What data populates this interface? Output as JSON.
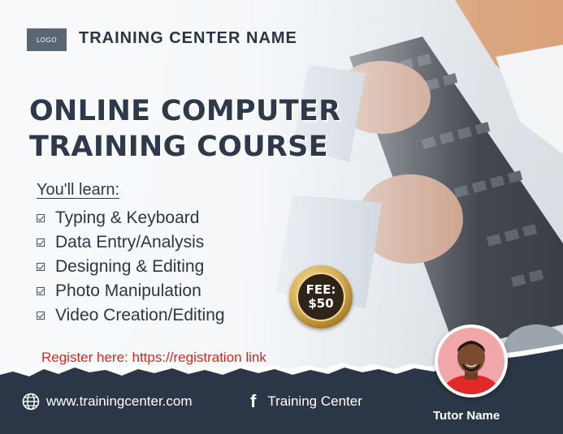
{
  "logo": {
    "text": "LOGO"
  },
  "center_name": "TRAINING CENTER NAME",
  "title": {
    "line1": "ONLINE COMPUTER",
    "line2": "TRAINING COURSE"
  },
  "learn": {
    "heading": "You'll learn:",
    "items": [
      {
        "label": "Typing & Keyboard"
      },
      {
        "label": "Data Entry/Analysis"
      },
      {
        "label": "Designing & Editing"
      },
      {
        "label": "Photo Manipulation"
      },
      {
        "label": "Video Creation/Editing"
      }
    ]
  },
  "fee": {
    "label": "FEE:",
    "amount": "$50"
  },
  "register": "Register here: https://registration link",
  "footer": {
    "website": "www.trainingcenter.com",
    "website_icon": "globe-icon",
    "facebook": "Training Center",
    "facebook_icon": "facebook-icon"
  },
  "tutor": {
    "name": "Tutor Name"
  },
  "colors": {
    "navy": "#2b3646",
    "red": "#d7281c",
    "gold": "#d8b25a",
    "avatar_bg": "#f1a6a9"
  }
}
